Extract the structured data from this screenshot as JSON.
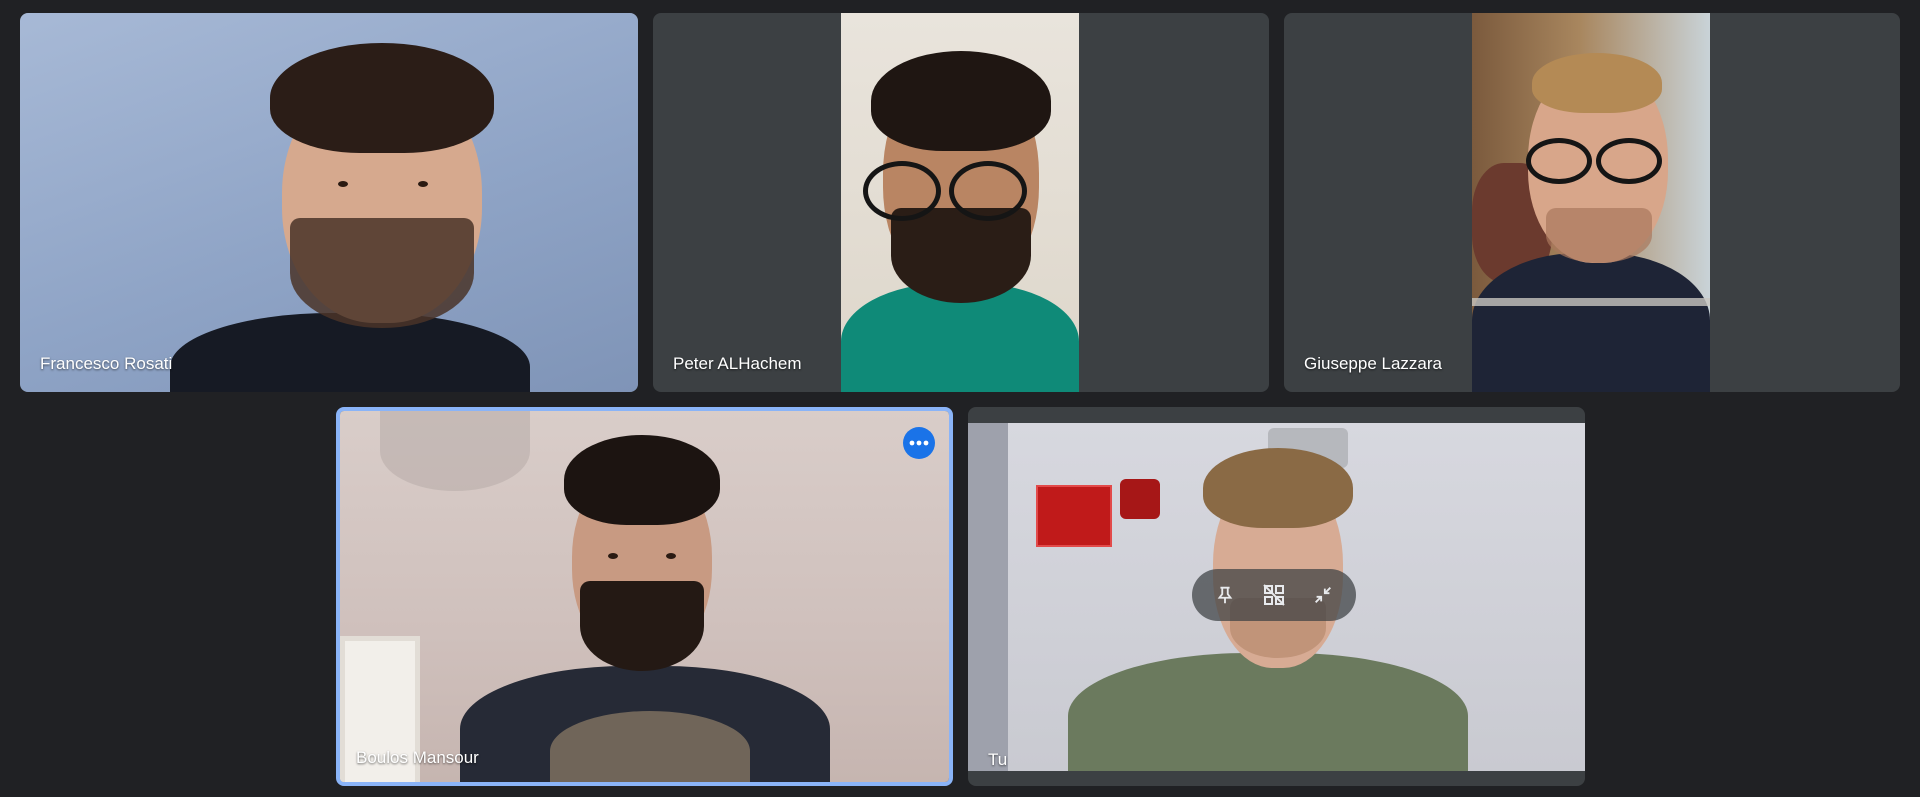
{
  "participants": [
    {
      "name": "Francesco Rosati"
    },
    {
      "name": "Peter ALHachem"
    },
    {
      "name": "Giuseppe Lazzara"
    },
    {
      "name": "Boulos Mansour"
    },
    {
      "name": "Tu"
    }
  ],
  "tile_controls": [
    "pin-icon",
    "remove-from-grid-icon",
    "minimize-icon"
  ],
  "more_options_icon": "more-horiz-icon",
  "colors": {
    "background": "#202124",
    "tile": "#3c4043",
    "active_border": "#8ab4f8",
    "accent": "#1a73e8"
  }
}
